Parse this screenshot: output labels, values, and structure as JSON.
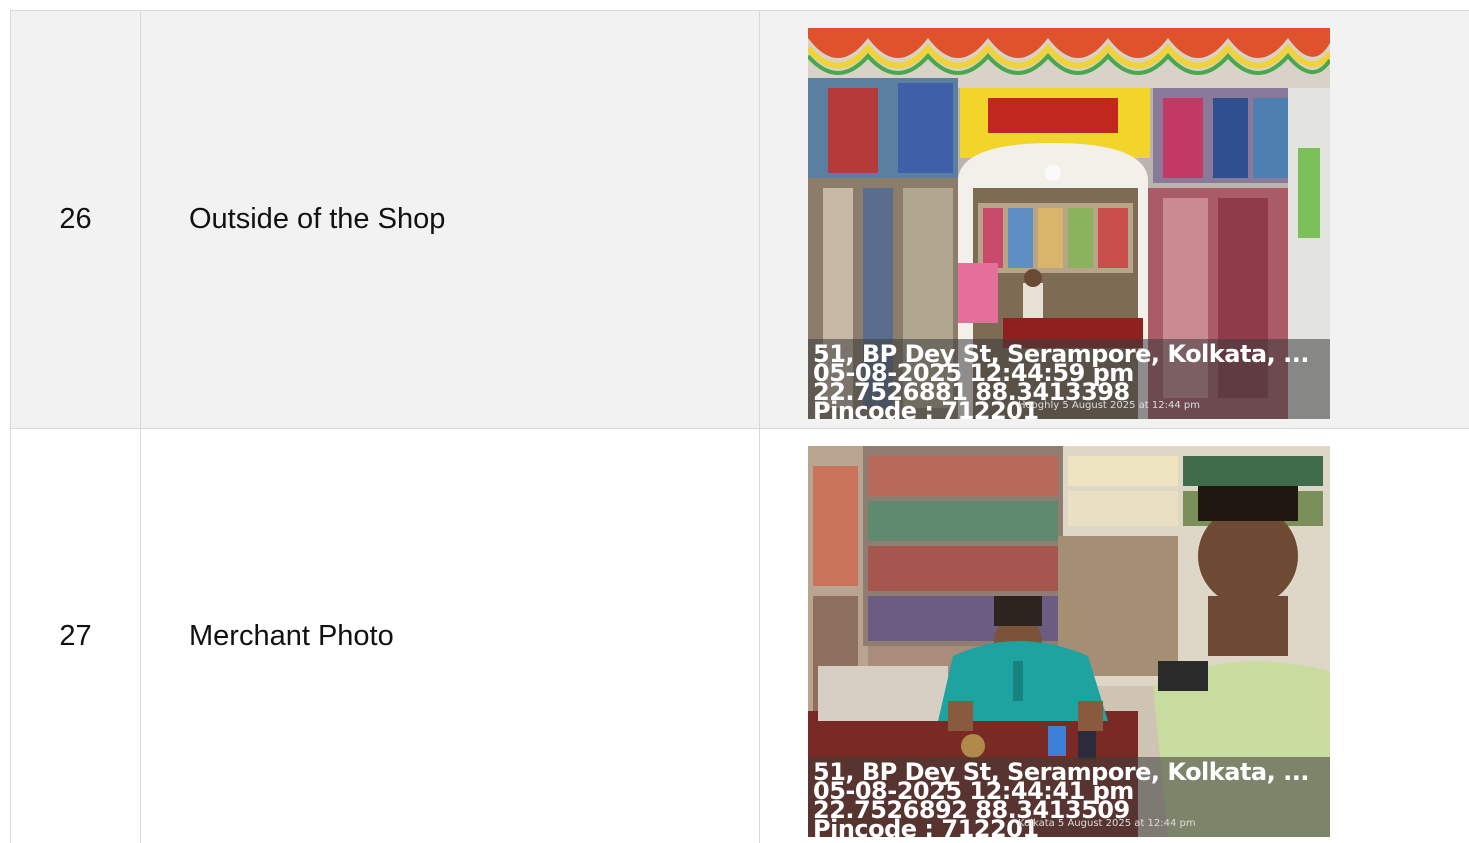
{
  "rows": [
    {
      "number": "26",
      "label": "Outside of the Shop",
      "stamp": {
        "address": "51, BP Dey St, Serampore, Kolkata, ...",
        "datetime": "05-08-2025 12:44:59 pm",
        "coords": "22.7526881 88.3413398",
        "pincode": "Pincode : 712201",
        "overlay": "Hooghly  5 August 2025 at 12:44 pm"
      },
      "photo_subject": "shop-exterior"
    },
    {
      "number": "27",
      "label": "Merchant Photo",
      "stamp": {
        "address": "51, BP Dey St, Serampore, Kolkata, ...",
        "datetime": "05-08-2025 12:44:41 pm",
        "coords": "22.7526892 88.3413509",
        "pincode": "Pincode : 712201",
        "overlay": "Kolkata  5 August 2025 at 12:44 pm"
      },
      "photo_subject": "merchant-interior"
    }
  ]
}
